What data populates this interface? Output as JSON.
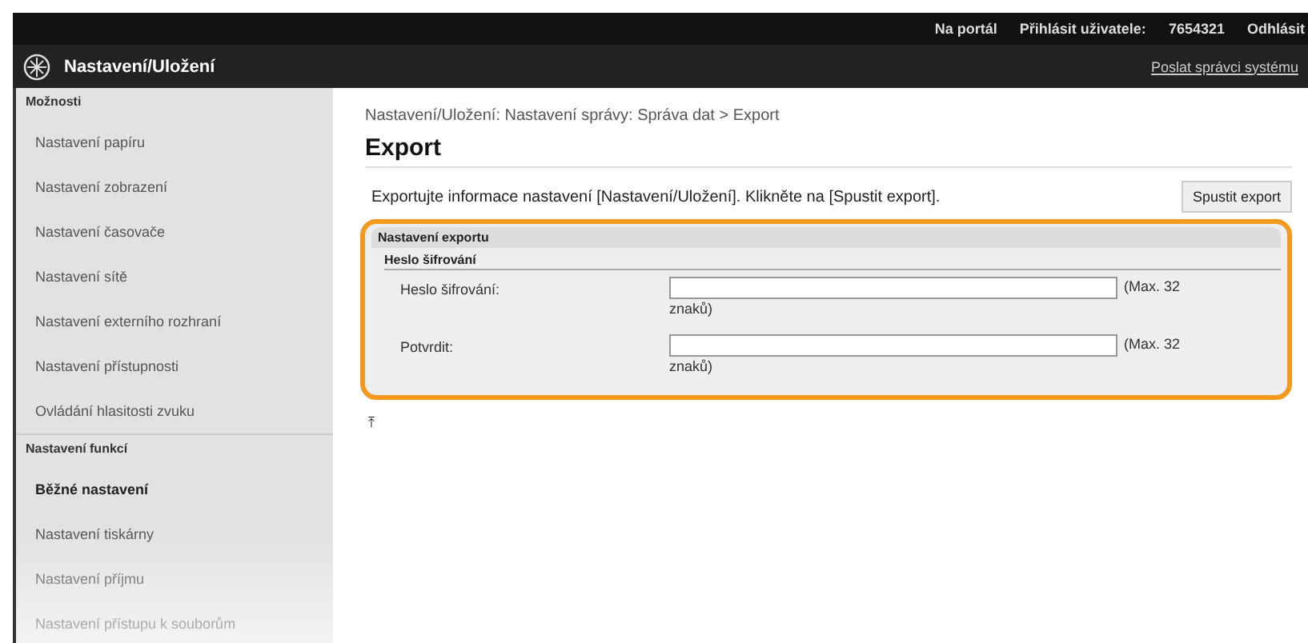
{
  "top_bar": {
    "links": [
      "Na portál",
      "Přihlásit uživatele:",
      "7654321",
      "Odhlásit"
    ]
  },
  "header": {
    "title": "Nastavení/Uložení",
    "link": "Poslat správci systému"
  },
  "sidebar": {
    "sections": [
      {
        "title": "Možnosti",
        "items": [
          {
            "label": "Nastavení papíru",
            "selected": false
          },
          {
            "label": "Nastavení zobrazení",
            "selected": false
          },
          {
            "label": "Nastavení časovače",
            "selected": false
          },
          {
            "label": "Nastavení sítě",
            "selected": false
          },
          {
            "label": "Nastavení externího rozhraní",
            "selected": false
          },
          {
            "label": "Nastavení přístupnosti",
            "selected": false
          },
          {
            "label": "Ovládání hlasitosti zvuku",
            "selected": false
          }
        ]
      },
      {
        "title": "Nastavení funkcí",
        "items": [
          {
            "label": "Běžné nastavení",
            "selected": true
          },
          {
            "label": "Nastavení tiskárny",
            "selected": false
          },
          {
            "label": "Nastavení příjmu",
            "selected": false
          },
          {
            "label": "Nastavení přístupu k souborům",
            "selected": false
          }
        ]
      }
    ]
  },
  "breadcrumb": "Nastavení/Uložení: Nastavení správy: Správa dat > Export",
  "page_title": "Export",
  "description": "Exportujte informace nastavení [Nastavení/Uložení]. Klikněte na [Spustit export].",
  "run_button": "Spustit export",
  "panel": {
    "title": "Nastavení exportu",
    "subtitle": "Heslo šifrování",
    "fields": [
      {
        "label": "Heslo šifrování:",
        "hint": "(Max. 32",
        "hint_wrap": "znaků)"
      },
      {
        "label": "Potvrdit:",
        "hint": "(Max. 32",
        "hint_wrap": "znaků)"
      }
    ]
  },
  "back_to_top": "⤒"
}
